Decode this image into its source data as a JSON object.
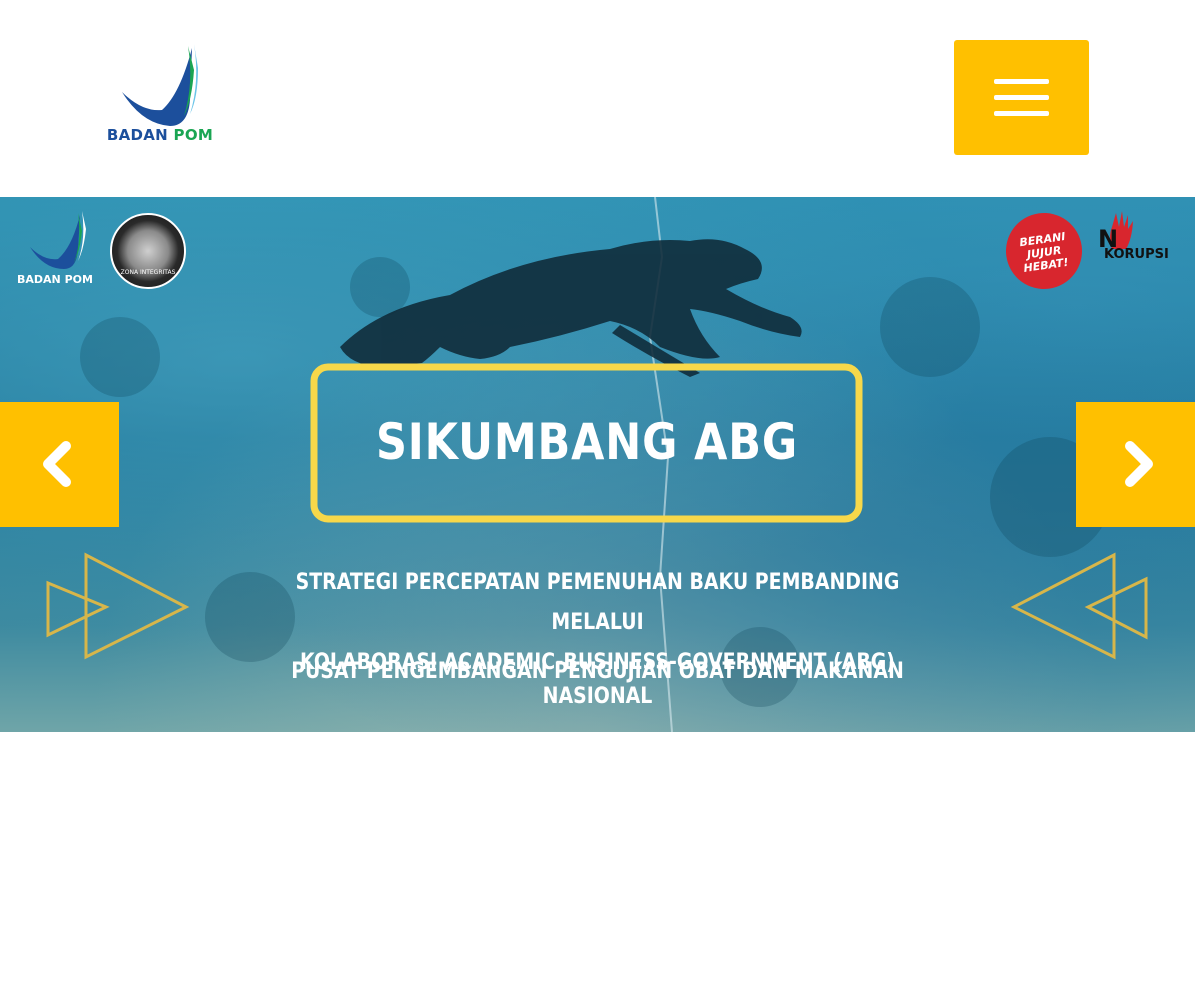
{
  "header": {
    "logo": {
      "word1": "BADAN",
      "word2": "POM",
      "colors": {
        "primary": "#1c4f9c",
        "secondary": "#1aa553"
      }
    },
    "menu_button": {
      "icon": "hamburger-menu-icon",
      "color": "#ffc000"
    }
  },
  "slider": {
    "slide": {
      "top_left_logo": {
        "word1": "BADAN",
        "word2": "POM"
      },
      "seal": {
        "ring_text": "KEMENTERIAN PANRB",
        "bottom_text": "ZONA INTEGRITAS"
      },
      "badge": {
        "line1": "BERANI",
        "line2": "JUJUR",
        "line3": "HEBAT!"
      },
      "no_korupsi": {
        "n": "N",
        "rest": "KORUPSI"
      },
      "title": "SIKUMBANG ABG",
      "subtitle_line1": "STRATEGI PERCEPATAN PEMENUHAN BAKU PEMBANDING MELALUI",
      "subtitle_line2": "KOLABORASI ACADEMIC-BUSINESS-GOVERNMENT (ABG)",
      "org": "PUSAT PENGEMBANGAN PENGUJIAN OBAT DAN MAKANAN NASIONAL"
    },
    "prev_button": {
      "icon": "chevron-left-icon"
    },
    "next_button": {
      "icon": "chevron-right-icon"
    },
    "accent_color": "#ffc000",
    "frame_color": "#f7d84a"
  }
}
